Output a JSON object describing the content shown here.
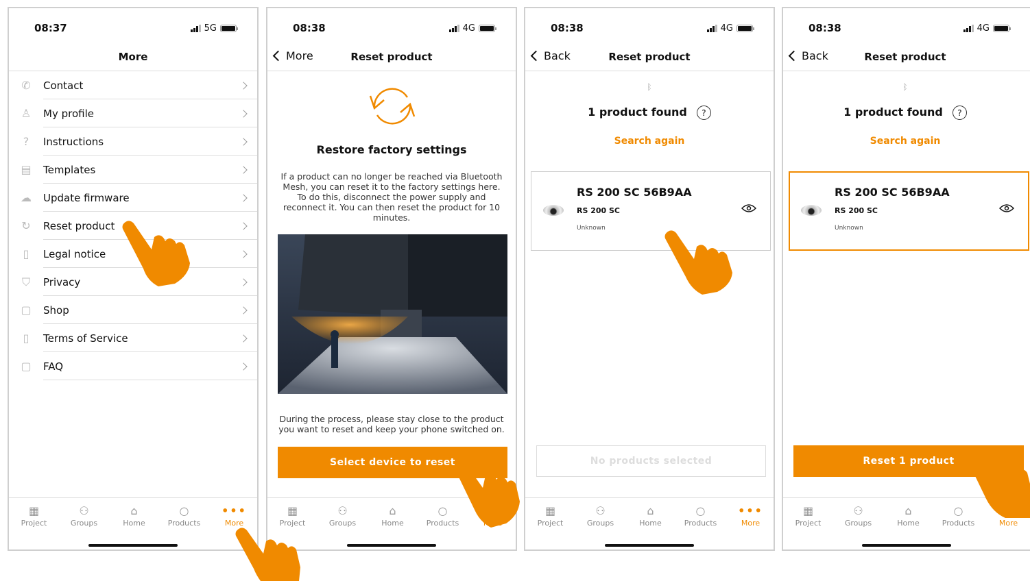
{
  "status": {
    "p1": {
      "time": "08:37",
      "network": "5G"
    },
    "p2": {
      "time": "08:38",
      "network": "4G"
    },
    "p3": {
      "time": "08:38",
      "network": "4G"
    },
    "p4": {
      "time": "08:38",
      "network": "4G"
    }
  },
  "screen1": {
    "title": "More",
    "items": [
      {
        "label": "Contact",
        "icon": "phone-icon"
      },
      {
        "label": "My profile",
        "icon": "person-icon"
      },
      {
        "label": "Instructions",
        "icon": "question-icon"
      },
      {
        "label": "Templates",
        "icon": "document-icon"
      },
      {
        "label": "Update firmware",
        "icon": "cloud-download-icon"
      },
      {
        "label": "Reset product",
        "icon": "refresh-icon"
      },
      {
        "label": "Legal notice",
        "icon": "book-icon"
      },
      {
        "label": "Privacy",
        "icon": "shield-icon"
      },
      {
        "label": "Shop",
        "icon": "shop-icon"
      },
      {
        "label": "Terms of Service",
        "icon": "book-icon"
      },
      {
        "label": "FAQ",
        "icon": "faq-icon"
      }
    ]
  },
  "screen2": {
    "back_label": "More",
    "title": "Reset product",
    "heading": "Restore factory settings",
    "description": "If a product can no longer be reached via Bluetooth Mesh, you can reset it to the factory settings here. To do this, disconnect the power supply and reconnect it. You can then reset the product for 10 minutes.",
    "note": "During the process, please stay close to the product you want to reset and keep your phone switched on.",
    "button": "Select device to reset"
  },
  "screen3": {
    "back_label": "Back",
    "title": "Reset product",
    "found": "1 product found",
    "search_again": "Search again",
    "product": {
      "name": "RS 200 SC 56B9AA",
      "model": "RS 200 SC",
      "state": "Unknown"
    },
    "button": "No products selected"
  },
  "screen4": {
    "back_label": "Back",
    "title": "Reset product",
    "found": "1 product found",
    "search_again": "Search again",
    "product": {
      "name": "RS 200 SC 56B9AA",
      "model": "RS 200 SC",
      "state": "Unknown"
    },
    "button": "Reset 1 product"
  },
  "tabs": [
    {
      "label": "Project",
      "icon": "building-icon"
    },
    {
      "label": "Groups",
      "icon": "groups-icon"
    },
    {
      "label": "Home",
      "icon": "home-icon"
    },
    {
      "label": "Products",
      "icon": "product-icon"
    },
    {
      "label": "More",
      "icon": "more-dots-icon"
    }
  ],
  "colors": {
    "accent": "#f08a00",
    "text": "#111111",
    "muted": "#888888"
  }
}
